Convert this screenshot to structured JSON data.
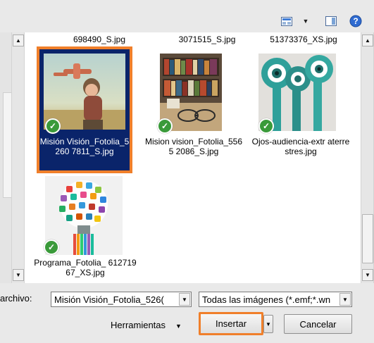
{
  "toolbar": {
    "view_icon": "view-menu-icon",
    "dropdown_icon": "dropdown-arrow-icon",
    "preview_pane_icon": "preview-pane-icon",
    "help_icon": "help-icon"
  },
  "files_top_row": [
    "698490_S.jpg",
    "3071515_S.jpg",
    "51373376_XS.jpg"
  ],
  "files": [
    {
      "name": "Misión Visión_Fotolia_52607811_S.jpg",
      "label": "Misión Visión_Fotolia_5260 7811_S.jpg",
      "selected": true,
      "synced": true
    },
    {
      "name": "Mision vision_Fotolia_55652086_S.jpg",
      "label": "Mision vision_Fotolia_5565 2086_S.jpg",
      "selected": false,
      "synced": true
    },
    {
      "name": "Ojos-audiencia-extraterrestres.jpg",
      "label": "Ojos-audiencia-extr aterrestres.jpg",
      "selected": false,
      "synced": true
    },
    {
      "name": "Programa_Fotolia_61271967_XS.jpg",
      "label": "Programa_Fotolia_ 61271967_XS.jpg",
      "selected": false,
      "synced": true
    }
  ],
  "filename": {
    "label": "archivo:",
    "value": "Misión Visión_Fotolia_526("
  },
  "filetype": {
    "value": "Todas las imágenes (*.emf;*.wn"
  },
  "buttons": {
    "tools": "Herramientas",
    "insert": "Insertar",
    "cancel": "Cancelar"
  },
  "colors": {
    "selection_bg": "#0a246a",
    "highlight": "#f07f2a",
    "check": "#3a9a3a"
  }
}
